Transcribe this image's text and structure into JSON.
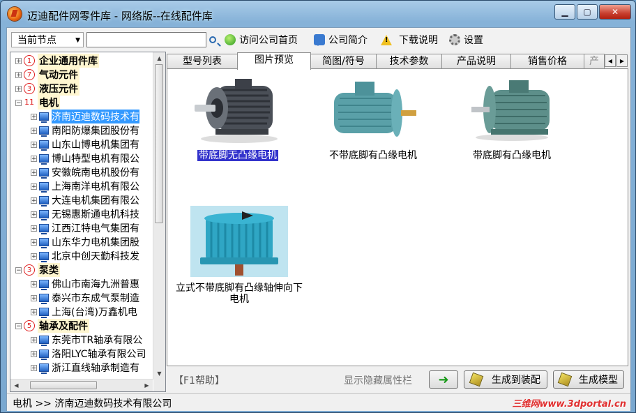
{
  "window": {
    "title": "迈迪配件网零件库 - 网络版--在线配件库"
  },
  "toolbar": {
    "node_select": "当前节点",
    "search_value": "",
    "visit_home": "访问公司首页",
    "company_intro": "公司简介",
    "download_help": "下载说明",
    "settings": "设置"
  },
  "tree": {
    "categories": [
      {
        "num": "1",
        "label": "企业通用件库",
        "expanded": false
      },
      {
        "num": "7",
        "label": "气动元件",
        "expanded": false
      },
      {
        "num": "3",
        "label": "液压元件",
        "expanded": false
      },
      {
        "num": "11",
        "label": "电机",
        "expanded": true,
        "children": [
          "济南迈迪数码技术有",
          "南阳防爆集团股份有",
          "山东山博电机集团有",
          "博山特型电机有限公",
          "安徽皖南电机股份有",
          "上海南洋电机有限公",
          "大连电机集团有限公",
          "无锡惠斯通电机科技",
          "江西江特电气集团有",
          "山东华力电机集团股",
          "北京中创天勤科技发"
        ]
      },
      {
        "num": "3",
        "label": "泵类",
        "expanded": true,
        "children": [
          "佛山市南海九洲普惠",
          "泰兴市东成气泵制造",
          "上海(台湾)万鑫机电"
        ]
      },
      {
        "num": "5",
        "label": "轴承及配件",
        "expanded": true,
        "children": [
          "东莞市TR轴承有限公",
          "洛阳LYC轴承有限公司",
          "浙江直线轴承制造有"
        ]
      }
    ],
    "selected": "济南迈迪数码技术有"
  },
  "tabs": [
    {
      "label": "型号列表"
    },
    {
      "label": "图片预览"
    },
    {
      "label": "简图/符号"
    },
    {
      "label": "技术参数"
    },
    {
      "label": "产品说明"
    },
    {
      "label": "销售价格"
    },
    {
      "label": "产"
    }
  ],
  "active_tab": "图片预览",
  "preview": [
    {
      "label": "带底脚无凸缘电机",
      "selected": true
    },
    {
      "label": "不带底脚有凸缘电机",
      "selected": false
    },
    {
      "label": "带底脚有凸缘电机",
      "selected": false
    },
    {
      "label": "立式不带底脚有凸缘轴伸向下电机",
      "selected": false
    }
  ],
  "bottom": {
    "help": "【F1帮助】",
    "show_hide": "显示隐藏属性栏",
    "gen_assembly": "生成到装配",
    "gen_model": "生成模型"
  },
  "status": {
    "path": "电机 >> 济南迈迪数码技术有限公司",
    "watermark": "三维网www.3dportal.cn"
  },
  "colors": {
    "selection": "#3399ff",
    "label_highlight": "#3333cc",
    "category_mark": "#e02020"
  }
}
